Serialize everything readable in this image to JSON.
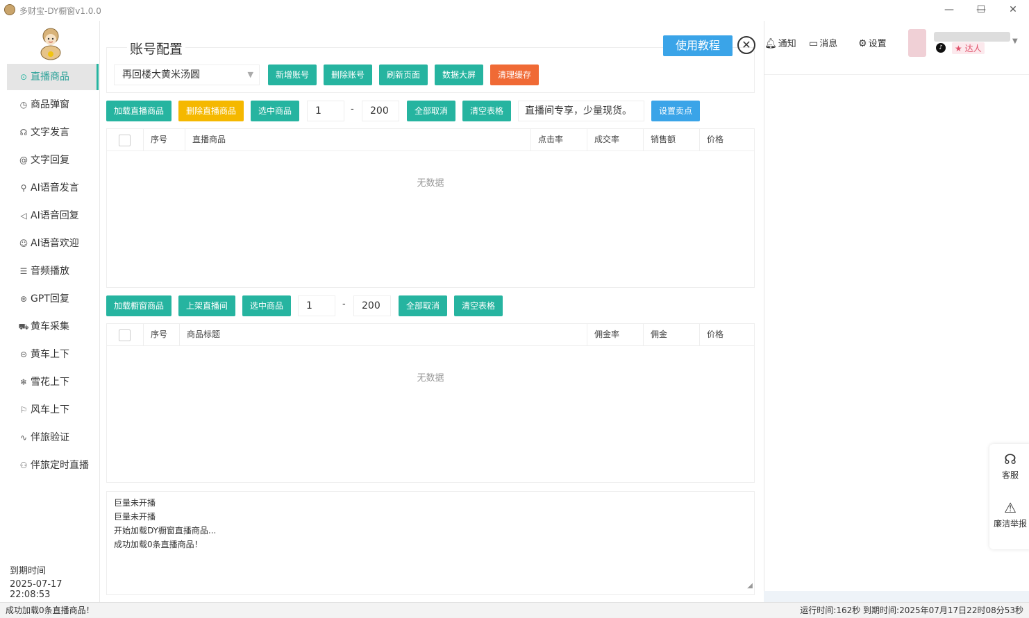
{
  "window": {
    "title": "多财宝-DY橱窗v1.0.0",
    "minimize": "—",
    "maximize": "☐",
    "close": "✕"
  },
  "sidebar": {
    "items": [
      {
        "icon": "⊙",
        "label": "直播商品",
        "active": true
      },
      {
        "icon": "◷",
        "label": "商品弹窗"
      },
      {
        "icon": "☊",
        "label": "文字发言"
      },
      {
        "icon": "@",
        "label": "文字回复"
      },
      {
        "icon": "⚲",
        "label": "AI语音发言"
      },
      {
        "icon": "◁",
        "label": "AI语音回复"
      },
      {
        "icon": "☺",
        "label": "AI语音欢迎"
      },
      {
        "icon": "☰",
        "label": "音频播放"
      },
      {
        "icon": "⊛",
        "label": "GPT回复"
      },
      {
        "icon": "⛟",
        "label": "黄车采集"
      },
      {
        "icon": "⊝",
        "label": "黄车上下"
      },
      {
        "icon": "❄",
        "label": "雪花上下"
      },
      {
        "icon": "⚐",
        "label": "风车上下"
      },
      {
        "icon": "∿",
        "label": "伴旅验证"
      },
      {
        "icon": "⚇",
        "label": "伴旅定时直播"
      }
    ],
    "expire_label": "到期时间",
    "expire_value": "2025-07-17 22:08:53"
  },
  "main": {
    "section_title": "账号配置",
    "tutorial_label": "使用教程",
    "close_glyph": "✕",
    "account_select": "再回楼大黄米汤圆",
    "account_buttons": [
      "新增账号",
      "删除账号",
      "刷新页面",
      "数据大屏",
      "清理缓存"
    ],
    "live_toolbar": {
      "load": "加载直播商品",
      "delete": "删除直播商品",
      "select": "选中商品",
      "from": "1",
      "dash": "-",
      "to": "200",
      "cancel_all": "全部取消",
      "clear": "清空表格",
      "selling_point": "直播间专享，少量现货。",
      "set_point": "设置卖点"
    },
    "live_table": {
      "columns": [
        "序号",
        "直播商品",
        "点击率",
        "成交率",
        "销售额",
        "价格"
      ],
      "empty": "无数据"
    },
    "window_toolbar": {
      "load": "加载橱窗商品",
      "list": "上架直播间",
      "select": "选中商品",
      "from": "1",
      "dash": "-",
      "to": "200",
      "cancel_all": "全部取消",
      "clear": "清空表格"
    },
    "window_table": {
      "columns": [
        "序号",
        "商品标题",
        "佣金率",
        "佣金",
        "价格"
      ],
      "empty": "无数据"
    },
    "log_lines": [
      "巨量未开播",
      "巨量未开播",
      "开始加载DY橱窗直播商品...",
      "成功加载0条直播商品！"
    ]
  },
  "right_panel": {
    "notify": "通知",
    "message": "消息",
    "settings": "设置",
    "badge": "达人",
    "float": {
      "service": "客服",
      "report": "廉洁举报"
    }
  },
  "status": {
    "left": "成功加载0条直播商品！",
    "right": "运行时间:162秒 到期时间:2025年07月17日22时08分53秒"
  },
  "colors": {
    "teal": "#26b4a0",
    "yellow": "#f5b800",
    "orange": "#f06a35",
    "blue": "#3aa4e8"
  }
}
